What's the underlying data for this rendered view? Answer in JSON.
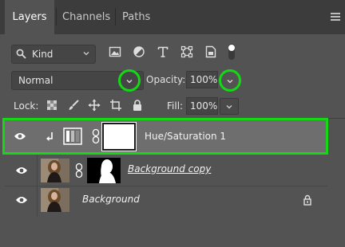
{
  "tabs": [
    {
      "label": "Layers",
      "active": true
    },
    {
      "label": "Channels",
      "active": false
    },
    {
      "label": "Paths",
      "active": false
    }
  ],
  "filter": {
    "kind_label": "Kind",
    "icons": [
      "image-filter-icon",
      "adjustment-filter-icon",
      "type-filter-icon",
      "shape-filter-icon",
      "smart-object-filter-icon"
    ]
  },
  "blend_mode": "Normal",
  "opacity": {
    "label": "Opacity:",
    "value": "100%"
  },
  "lock": {
    "label": "Lock:",
    "icons": [
      "lock-transparent-icon",
      "lock-paint-icon",
      "lock-position-icon",
      "lock-artboard-icon",
      "lock-all-icon"
    ]
  },
  "fill": {
    "label": "Fill:",
    "value": "100%"
  },
  "layers": [
    {
      "name": "Hue/Saturation 1",
      "type": "adjustment",
      "selected": true,
      "clipped": true
    },
    {
      "name": "Background copy",
      "type": "pixel-with-mask",
      "selected": false
    },
    {
      "name": "Background",
      "type": "background",
      "selected": false,
      "locked": true
    }
  ],
  "colors": {
    "highlight": "#15d815",
    "panel": "#535353",
    "selected_row": "#6e6e6e"
  }
}
